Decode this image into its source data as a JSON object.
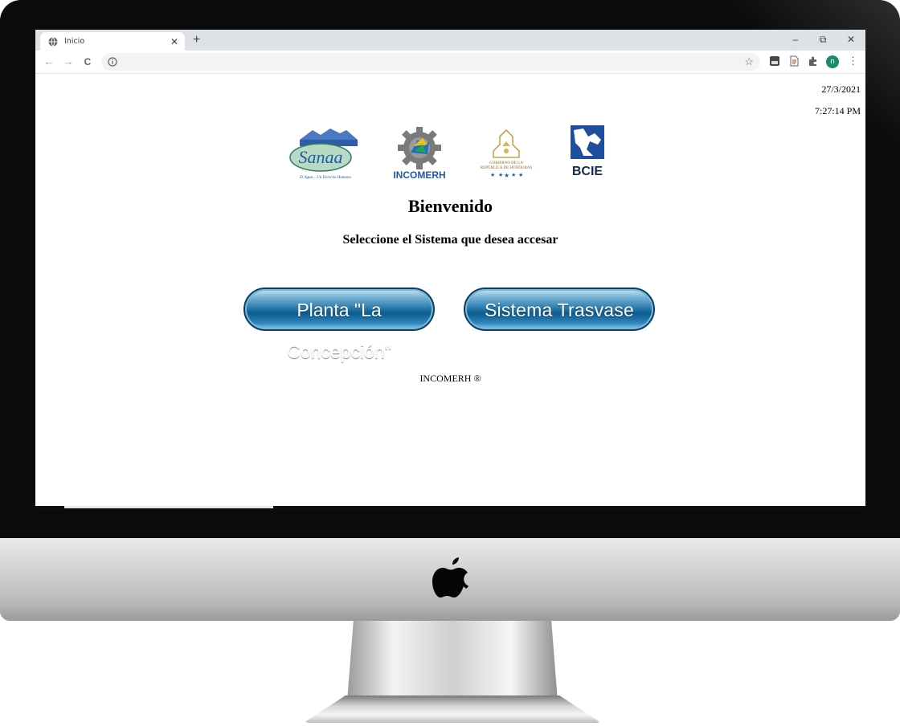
{
  "browser": {
    "tab_title": "Inicio",
    "tab_close": "✕",
    "new_tab": "+",
    "window_controls": {
      "minimize": "–",
      "restore": "⧉",
      "close": "✕"
    },
    "nav": {
      "back": "←",
      "forward": "→",
      "reload": "C"
    },
    "star": "☆",
    "avatar_initial": "n",
    "menu": "⋮",
    "extensions": [
      "selenium-ext-icon",
      "document-ext-icon",
      "puzzle-icon"
    ]
  },
  "page": {
    "date": "27/3/2021",
    "time": "7:27:14 PM",
    "logos": {
      "sanaa": {
        "wordmark": "Sanaa",
        "tagline": "El Agua... Un Derecho Humano"
      },
      "incomerh": {
        "wordmark": "INCOMERH"
      },
      "gobierno": {
        "line1": "GOBIERNO DE LA",
        "line2": "REPÚBLICA DE HONDURAS"
      },
      "bcie": {
        "wordmark": "BCIE"
      }
    },
    "welcome": "Bienvenido",
    "subtitle": "Seleccione el Sistema que desea accesar",
    "buttons": {
      "planta": "Planta \"La Concepción\"",
      "trasvase": "Sistema Trasvase"
    },
    "footer": "INCOMERH ®"
  },
  "colors": {
    "button_dark": "#0d5b8f",
    "button_light": "#8ccbe9",
    "avatar": "#1a8a6e",
    "tabstrip": "#dee1e6"
  }
}
